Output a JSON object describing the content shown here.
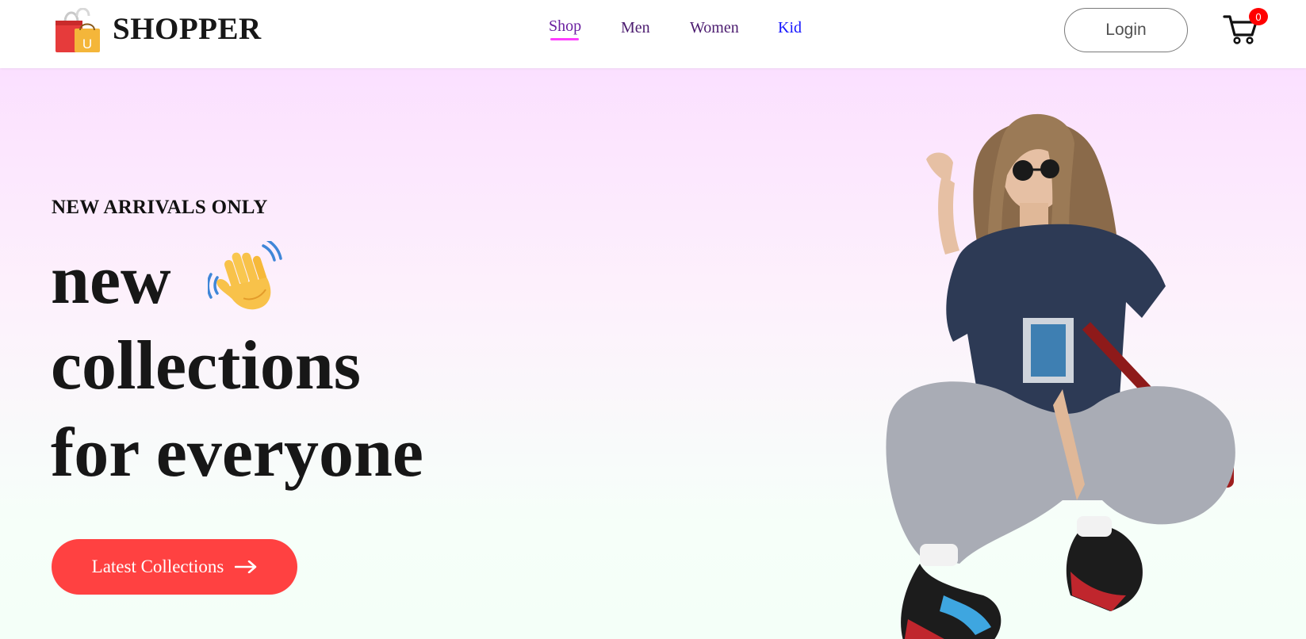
{
  "brand": {
    "name": "SHOPPER",
    "logo_letter": "U",
    "colors": {
      "bag_red": "#e63b3b",
      "bag_yellow": "#f4b63a"
    }
  },
  "nav": {
    "items": [
      {
        "label": "Shop",
        "active": true
      },
      {
        "label": "Men"
      },
      {
        "label": "Women"
      },
      {
        "label": "Kid"
      }
    ],
    "active_indicator_color": "#ff3dff"
  },
  "header_actions": {
    "login_label": "Login",
    "cart_icon": "shopping-cart-icon",
    "cart_count": "0",
    "badge_color": "#ff0000"
  },
  "hero": {
    "eyebrow": "NEW ARRIVALS ONLY",
    "headline_lines": [
      "new",
      "collections",
      "for everyone"
    ],
    "emoji_icon": "waving-hand-icon",
    "cta_label": "Latest Collections",
    "cta_icon": "arrow-right-icon",
    "cta_color": "#ff4141",
    "image_icon": "fashion-model-image",
    "gradient_colors": [
      "#fbe0ff",
      "#f4fff8"
    ]
  }
}
